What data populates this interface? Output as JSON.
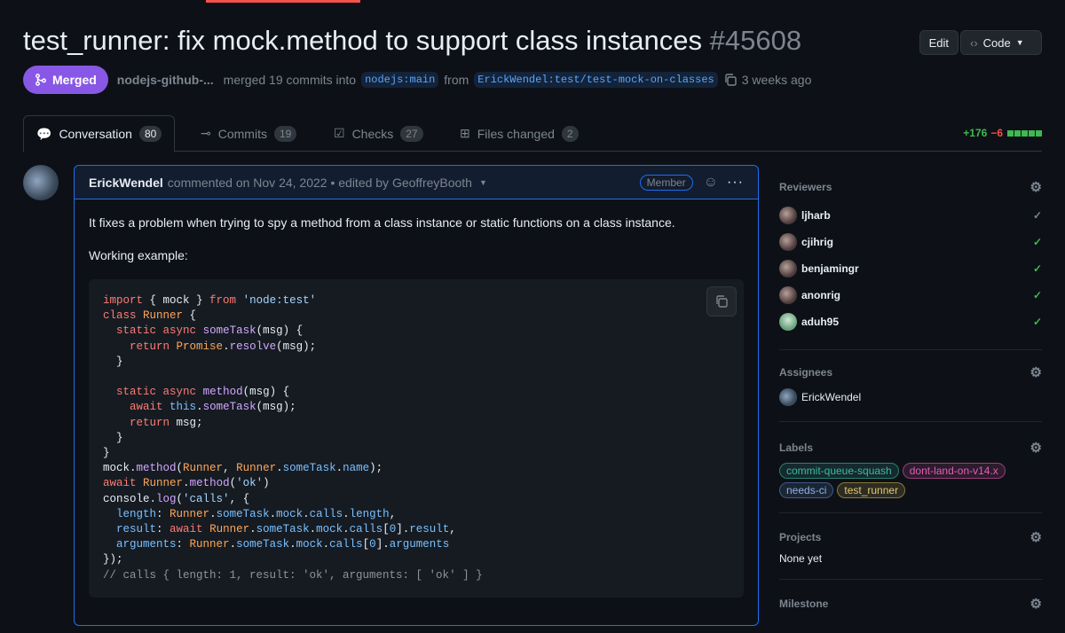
{
  "header": {
    "title": "test_runner: fix mock.method to support class instances",
    "number": "#45608",
    "edit_label": "Edit",
    "code_label": "Code"
  },
  "meta": {
    "status": "Merged",
    "author": "nodejs-github-...",
    "merged_text": "merged 19 commits into",
    "base_branch": "nodejs:main",
    "from_text": "from",
    "head_branch": "ErickWendel:test/test-mock-on-classes",
    "time": "3 weeks ago"
  },
  "tabs": [
    {
      "label": "Conversation",
      "count": "80"
    },
    {
      "label": "Commits",
      "count": "19"
    },
    {
      "label": "Checks",
      "count": "27"
    },
    {
      "label": "Files changed",
      "count": "2"
    }
  ],
  "diffstat": {
    "additions": "+176",
    "deletions": "−6"
  },
  "comment": {
    "author": "ErickWendel",
    "action": "commented on Nov 24, 2022 • edited by GeoffreyBooth",
    "role": "Member",
    "text1": "It fixes a problem when trying to spy a method from a class instance or static functions on a class instance.",
    "text2": "Working example:"
  },
  "sidebar": {
    "reviewers_title": "Reviewers",
    "reviewers": [
      {
        "name": "ljharb",
        "state": "approved-gray"
      },
      {
        "name": "cjihrig",
        "state": "approved"
      },
      {
        "name": "benjamingr",
        "state": "approved"
      },
      {
        "name": "anonrig",
        "state": "approved"
      },
      {
        "name": "aduh95",
        "state": "approved"
      }
    ],
    "assignees_title": "Assignees",
    "assignee": "ErickWendel",
    "labels_title": "Labels",
    "labels": [
      {
        "name": "commit-queue-squash",
        "color": "#3fb9a6"
      },
      {
        "name": "dont-land-on-v14.x",
        "color": "#e65cb8"
      },
      {
        "name": "needs-ci",
        "color": "#6e97d8"
      },
      {
        "name": "test_runner",
        "color": "#e3c76b"
      }
    ],
    "projects_title": "Projects",
    "projects_value": "None yet",
    "milestone_title": "Milestone"
  },
  "colors": {
    "merged": "#8957e5",
    "accent": "#1f6feb",
    "approved": "#3fb950"
  }
}
